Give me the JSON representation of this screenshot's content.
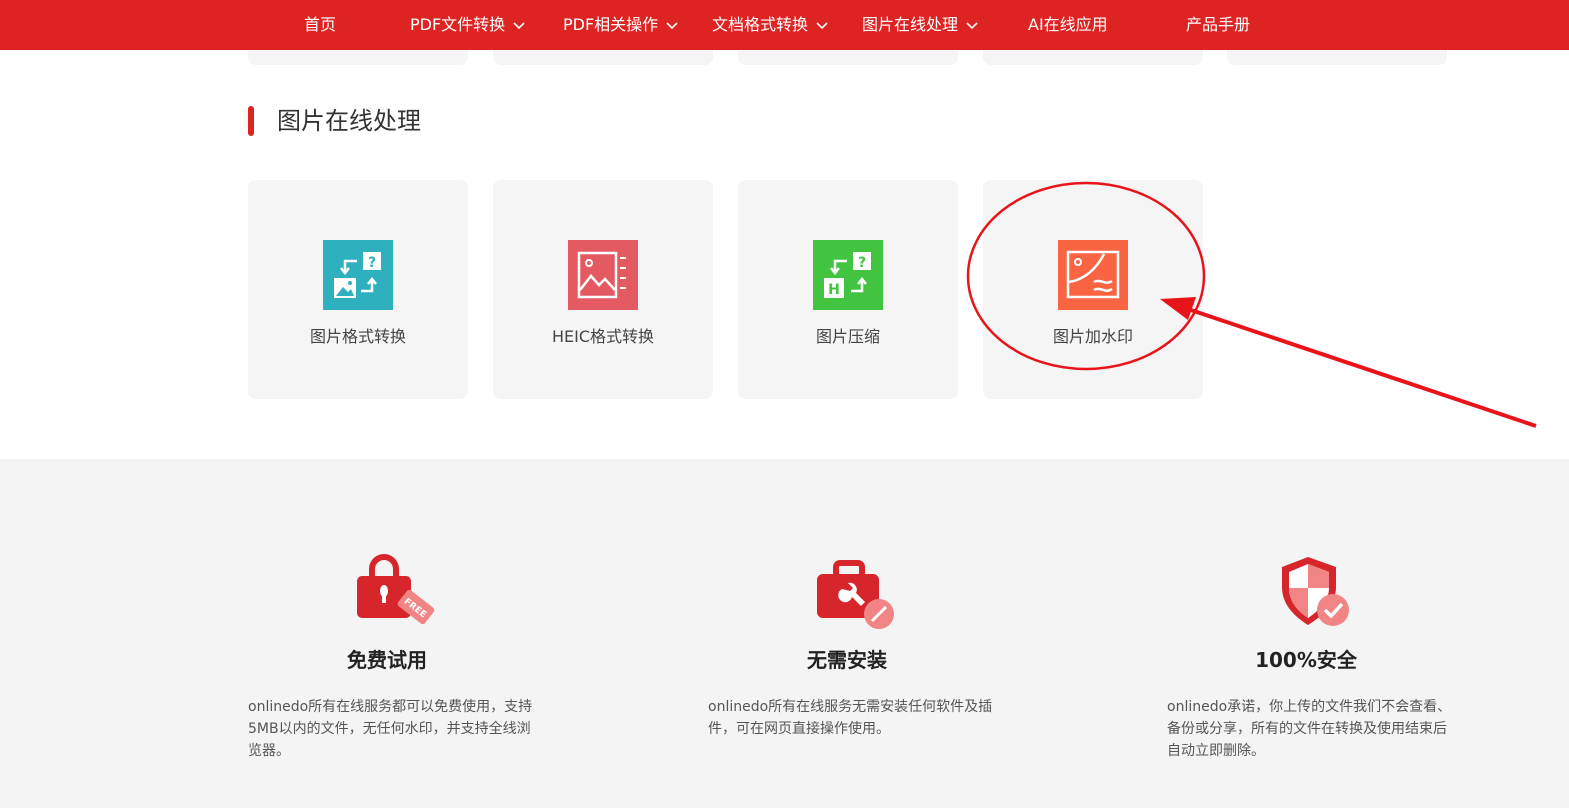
{
  "nav": {
    "items": [
      {
        "label": "首页",
        "dropdown": false
      },
      {
        "label": "PDF文件转换",
        "dropdown": true
      },
      {
        "label": "PDF相关操作",
        "dropdown": true
      },
      {
        "label": "文档格式转换",
        "dropdown": true
      },
      {
        "label": "图片在线处理",
        "dropdown": true
      },
      {
        "label": "AI在线应用",
        "dropdown": false
      },
      {
        "label": "产品手册",
        "dropdown": false
      }
    ]
  },
  "section": {
    "title": "图片在线处理",
    "tools": [
      {
        "label": "图片格式转换",
        "icon": "image-format-convert-icon",
        "color": "#2fb0bf"
      },
      {
        "label": "HEIC格式转换",
        "icon": "heic-convert-icon",
        "color": "#e35a62"
      },
      {
        "label": "图片压缩",
        "icon": "image-compress-icon",
        "color": "#43c440"
      },
      {
        "label": "图片加水印",
        "icon": "image-watermark-icon",
        "color": "#f96443"
      }
    ]
  },
  "features": [
    {
      "title": "免费试用",
      "icon": "lock-free-icon",
      "desc": "onlinedo所有在线服务都可以免费使用，支持5MB以内的文件，无任何水印，并支持全线浏览器。"
    },
    {
      "title": "无需安装",
      "icon": "toolbox-icon",
      "desc": "onlinedo所有在线服务无需安装任何软件及插件，可在网页直接操作使用。"
    },
    {
      "title": "100%安全",
      "icon": "shield-check-icon",
      "desc": "onlinedo承诺，你上传的文件我们不会查看、备份或分享，所有的文件在转换及使用结束后自动立即删除。"
    }
  ],
  "colors": {
    "brand": "#de2323",
    "annotation": "#e8141a"
  }
}
